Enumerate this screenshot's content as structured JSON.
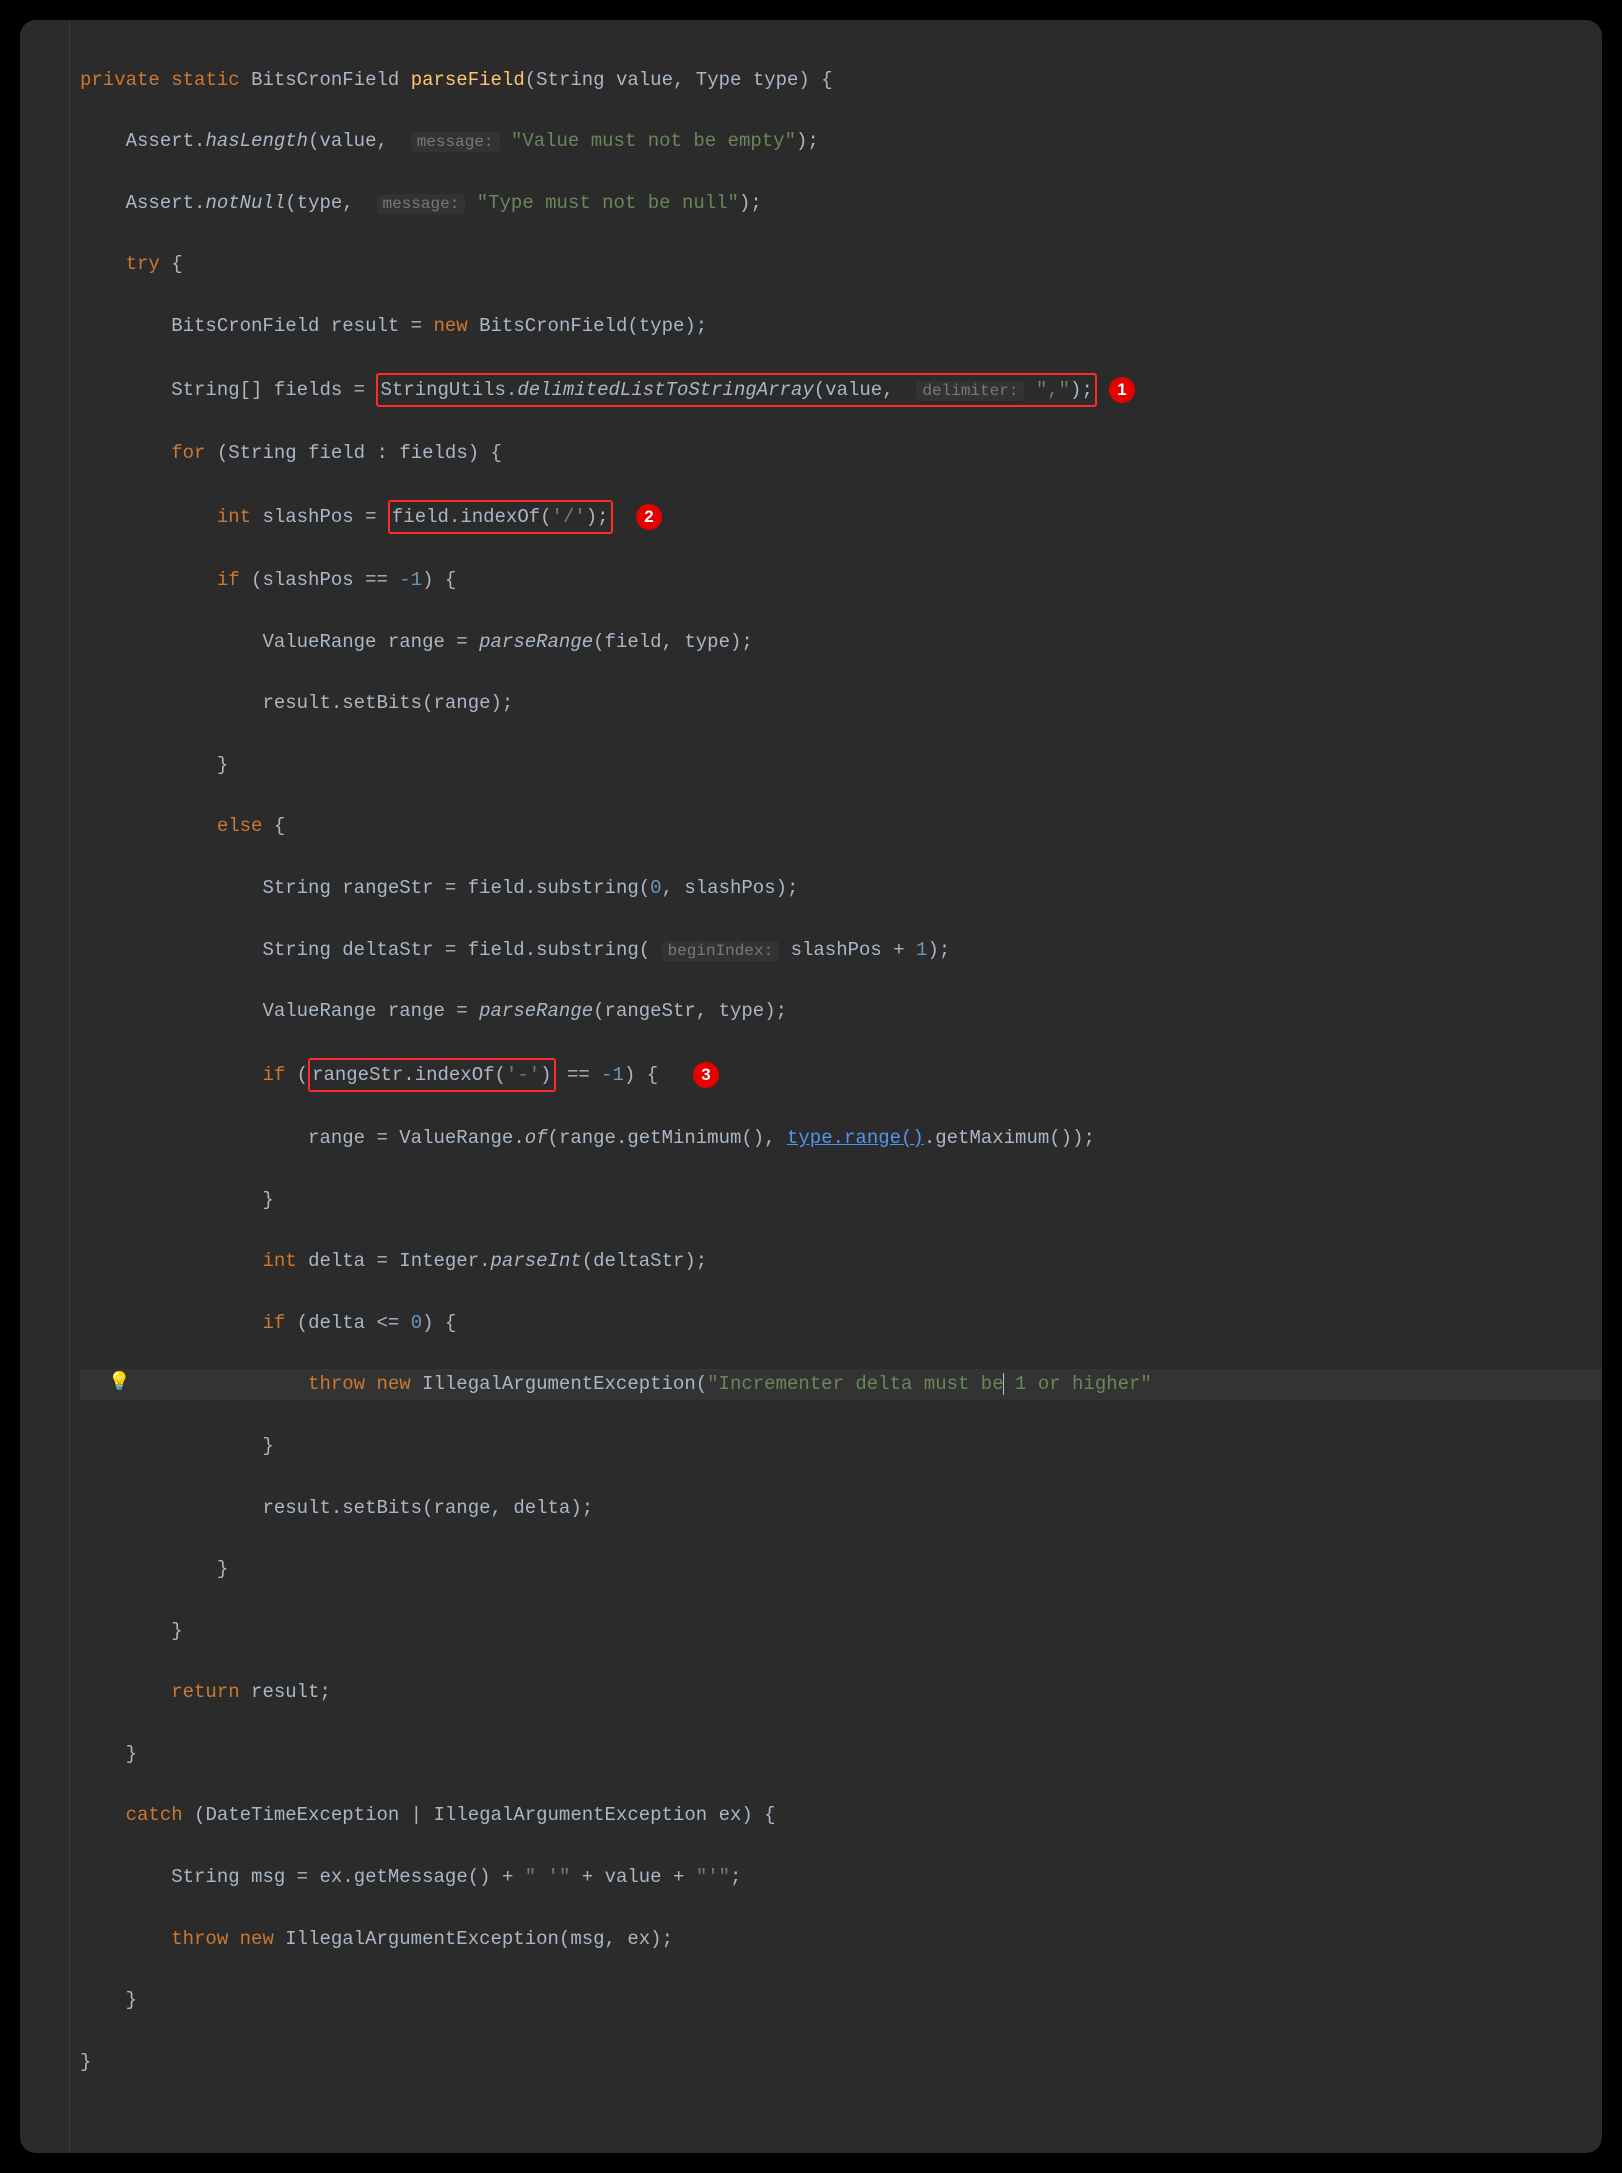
{
  "kw": {
    "private": "private",
    "static": "static",
    "try": "try",
    "new": "new",
    "for": "for",
    "int": "int",
    "if": "if",
    "else": "else",
    "throw": "throw",
    "return": "return",
    "catch": "catch"
  },
  "sig": {
    "retType": "BitsCronField",
    "name": "parseField",
    "p1type": "String",
    "p1name": "value",
    "p2type": "Type",
    "p2name": "type"
  },
  "assert1_cls": "Assert",
  "assert1_m": "hasLength",
  "assert1_arg": "value",
  "assert1_hint": "message:",
  "assert1_str": "\"Value must not be empty\"",
  "assert2_cls": "Assert",
  "assert2_m": "notNull",
  "assert2_arg": "type",
  "assert2_hint": "message:",
  "assert2_str": "\"Type must not be null\"",
  "l5_type": "BitsCronField",
  "l5_var": "result",
  "l5_ctor": "BitsCronField",
  "l5_arg": "type",
  "l6_type": "String[]",
  "l6_var": "fields",
  "l6_cls": "StringUtils",
  "l6_m": "delimitedListToStringArray",
  "l6_arg1": "value",
  "l6_hint": "delimiter:",
  "l6_str": "\",\"",
  "badge1": "1",
  "l7_itype": "String",
  "l7_ivar": "field",
  "l7_coll": "fields",
  "l8_var": "slashPos",
  "l8_expr_obj": "field",
  "l8_expr_m": "indexOf",
  "l8_expr_arg": "'/'",
  "badge2": "2",
  "l9_cond_var": "slashPos",
  "l9_cond_val": "-1",
  "l10_type": "ValueRange",
  "l10_var": "range",
  "l10_m": "parseRange",
  "l10_a1": "field",
  "l10_a2": "type",
  "l11_obj": "result",
  "l11_m": "setBits",
  "l11_a": "range",
  "l14_type": "String",
  "l14_var": "rangeStr",
  "l14_obj": "field",
  "l14_m": "substring",
  "l14_a1": "0",
  "l14_a2": "slashPos",
  "l15_type": "String",
  "l15_var": "deltaStr",
  "l15_obj": "field",
  "l15_m": "substring",
  "l15_hint": "beginIndex:",
  "l15_a1": "slashPos",
  "l15_a2": "1",
  "l16_type": "ValueRange",
  "l16_var": "range",
  "l16_m": "parseRange",
  "l16_a1": "rangeStr",
  "l16_a2": "type",
  "l17_obj": "rangeStr",
  "l17_m": "indexOf",
  "l17_a": "'-'",
  "l17_val": "-1",
  "badge3": "3",
  "l18_var": "range",
  "l18_cls": "ValueRange",
  "l18_m": "of",
  "l18_a1o": "range",
  "l18_a1m": "getMinimum",
  "l18_link": "type.range()",
  "l18_a2m": "getMaximum",
  "l20_var": "delta",
  "l20_cls": "Integer",
  "l20_m": "parseInt",
  "l20_a": "deltaStr",
  "l21_var": "delta",
  "l21_val": "0",
  "l22_ex": "IllegalArgumentException",
  "l22_str1": "\"Incrementer delta must be",
  "l22_str2": " 1 or higher\"",
  "l24_obj": "result",
  "l24_m": "setBits",
  "l24_a1": "range",
  "l24_a2": "delta",
  "l27_ret": "result",
  "l29_ex1": "DateTimeException",
  "l29_ex2": "IllegalArgumentException",
  "l29_var": "ex",
  "l30_type": "String",
  "l30_var": "msg",
  "l30_obj": "ex",
  "l30_m": "getMessage",
  "l30_s1": "\" '\"",
  "l30_v": "value",
  "l30_s2": "\"'\"",
  "l31_ex": "IllegalArgumentException",
  "l31_a1": "msg",
  "l31_a2": "ex",
  "bulb": "💡"
}
